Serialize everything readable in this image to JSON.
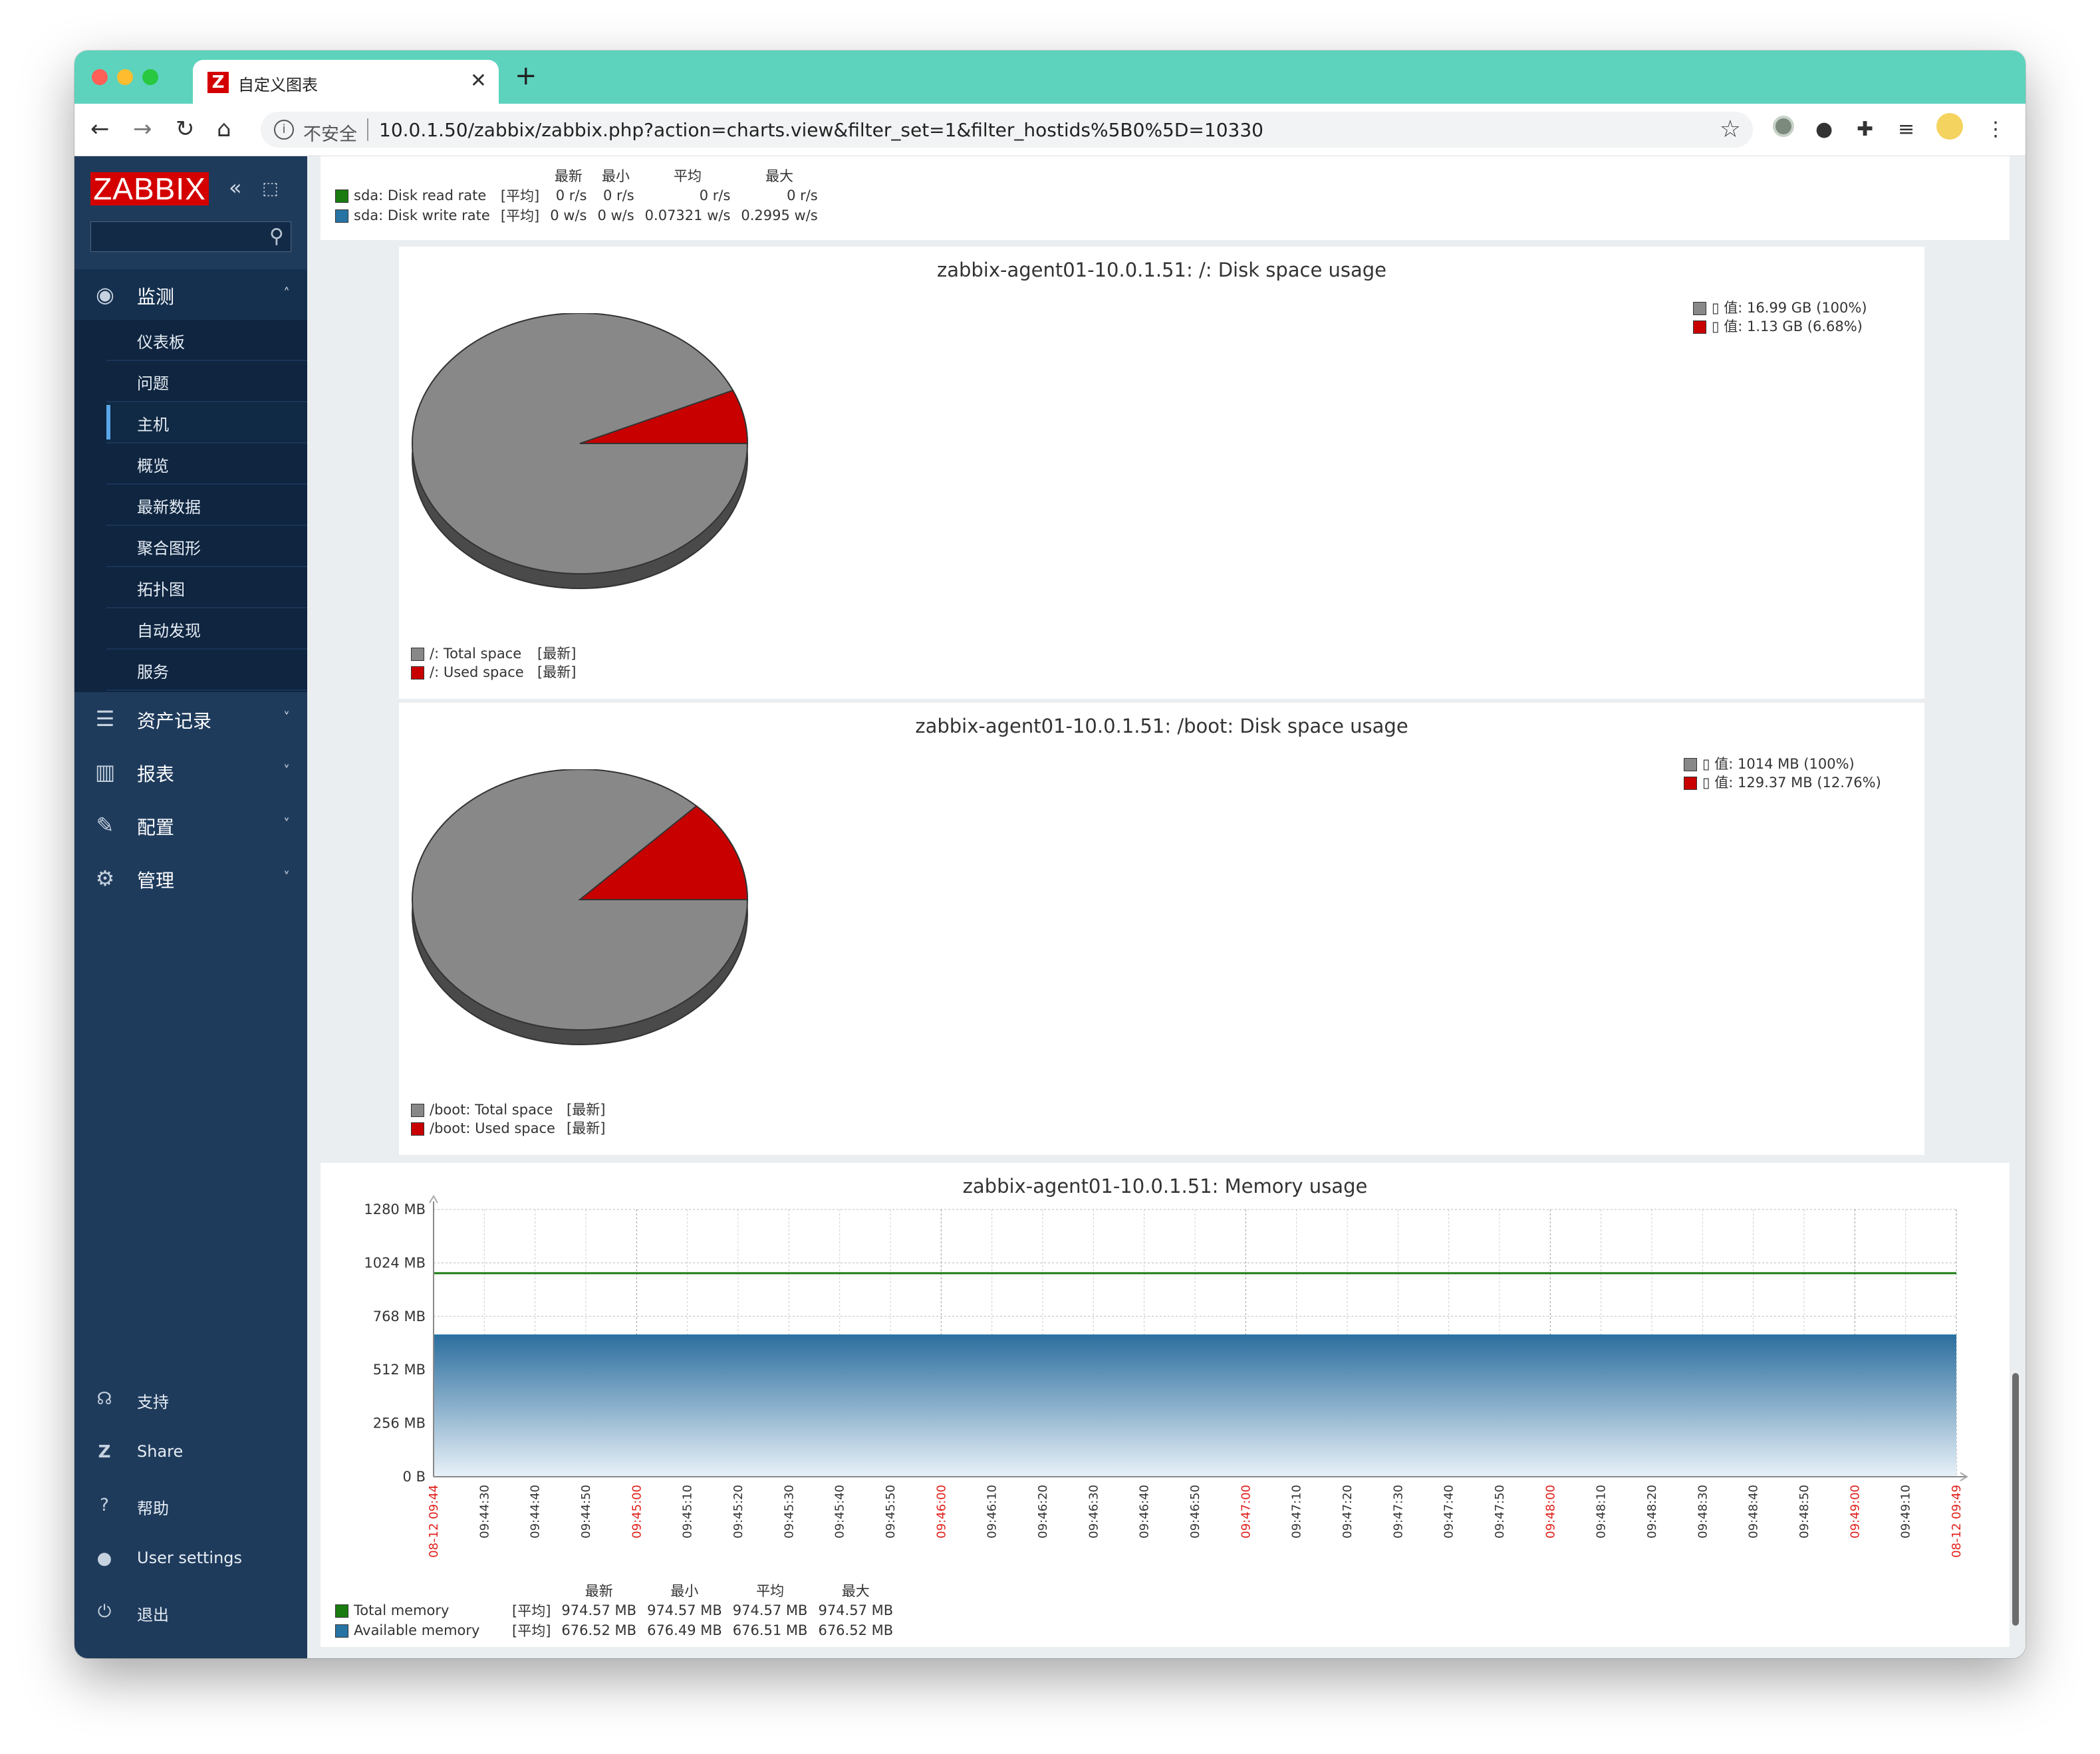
{
  "browser": {
    "tab_title": "自定义图表",
    "tab_favicon": "Z",
    "security_label": "不安全",
    "url": "10.0.1.50/zabbix/zabbix.php?action=charts.view&filter_set=1&filter_hostids%5B0%5D=10330",
    "icons": [
      "back-icon",
      "forward-icon",
      "reload-icon",
      "home-icon",
      "info-icon",
      "star-icon",
      "extension-icon",
      "bulb-icon",
      "puzzle-icon",
      "playlist-icon",
      "avatar-icon",
      "menu-icon"
    ]
  },
  "sidebar": {
    "logo": "ZABBIX",
    "search_placeholder": "",
    "menu": [
      {
        "label": "监测",
        "icon": "eye-icon",
        "expanded": true
      },
      {
        "label": "资产记录",
        "icon": "list-icon"
      },
      {
        "label": "报表",
        "icon": "bar-chart-icon"
      },
      {
        "label": "配置",
        "icon": "wrench-icon"
      },
      {
        "label": "管理",
        "icon": "gear-icon"
      }
    ],
    "submenu": [
      "仪表板",
      "问题",
      "主机",
      "概览",
      "最新数据",
      "聚合图形",
      "拓扑图",
      "自动发现",
      "服务"
    ],
    "active_submenu": "主机",
    "footer": [
      {
        "label": "支持",
        "icon": "headset-icon"
      },
      {
        "label": "Share",
        "icon": "zabbix-share-icon"
      },
      {
        "label": "帮助",
        "icon": "question-icon"
      },
      {
        "label": "User settings",
        "icon": "user-icon"
      },
      {
        "label": "退出",
        "icon": "power-icon"
      }
    ]
  },
  "disk_rate_legend": {
    "headers": [
      "最新",
      "最小",
      "平均",
      "最大"
    ],
    "rows": [
      {
        "name": "sda: Disk read rate",
        "func": "[平均]",
        "color": "#1a7c10",
        "last": "0 r/s",
        "min": "0 r/s",
        "avg": "0 r/s",
        "max": "0 r/s"
      },
      {
        "name": "sda: Disk write rate",
        "func": "[平均]",
        "color": "#2774a4",
        "last": "0 w/s",
        "min": "0 w/s",
        "avg": "0.07321 w/s",
        "max": "0.2995 w/s"
      }
    ]
  },
  "pie_root": {
    "title": "zabbix-agent01-10.0.1.51: /: Disk space usage",
    "values": [
      {
        "label": "/: Total space",
        "func": "[最新]",
        "value_text": "▯ 值: 16.99 GB (100%)",
        "color": "#888888"
      },
      {
        "label": "/: Used space",
        "func": "[最新]",
        "value_text": "▯ 值: 1.13 GB (6.68%)",
        "color": "#c80000"
      }
    ],
    "used_fraction": 0.0668
  },
  "pie_boot": {
    "title": "zabbix-agent01-10.0.1.51: /boot: Disk space usage",
    "values": [
      {
        "label": "/boot: Total space",
        "func": "[最新]",
        "value_text": "▯ 值: 1014 MB (100%)",
        "color": "#888888"
      },
      {
        "label": "/boot: Used space",
        "func": "[最新]",
        "value_text": "▯ 值: 129.37 MB (12.76%)",
        "color": "#c80000"
      }
    ],
    "used_fraction": 0.1276
  },
  "memory_legend": {
    "headers": [
      "最新",
      "最小",
      "平均",
      "最大"
    ],
    "rows": [
      {
        "name": "Total memory",
        "func": "[平均]",
        "color": "#1a7c10",
        "last": "974.57 MB",
        "min": "974.57 MB",
        "avg": "974.57 MB",
        "max": "974.57 MB"
      },
      {
        "name": "Available memory",
        "func": "[平均]",
        "color": "#2774a4",
        "last": "676.52 MB",
        "min": "676.49 MB",
        "avg": "676.51 MB",
        "max": "676.52 MB"
      }
    ]
  },
  "chart_data": {
    "type": "area",
    "title": "zabbix-agent01-10.0.1.51: Memory usage",
    "y_unit": "MB",
    "ylim": [
      0,
      1280
    ],
    "y_ticks": [
      "0 B",
      "256 MB",
      "512 MB",
      "768 MB",
      "1024 MB",
      "1280 MB"
    ],
    "y_tick_values": [
      0,
      256,
      512,
      768,
      1024,
      1280
    ],
    "x_ticks": [
      "08-12 09:44",
      "09:44:30",
      "09:44:40",
      "09:44:50",
      "09:45:00",
      "09:45:10",
      "09:45:20",
      "09:45:30",
      "09:45:40",
      "09:45:50",
      "09:46:00",
      "09:46:10",
      "09:46:20",
      "09:46:30",
      "09:46:40",
      "09:46:50",
      "09:47:00",
      "09:47:10",
      "09:47:20",
      "09:47:30",
      "09:47:40",
      "09:47:50",
      "09:48:00",
      "09:48:10",
      "09:48:20",
      "09:48:30",
      "09:48:40",
      "09:48:50",
      "09:49:00",
      "09:49:10",
      "08-12 09:49"
    ],
    "x_major_ticks": [
      "08-12 09:44",
      "09:45:00",
      "09:46:00",
      "09:47:00",
      "09:48:00",
      "09:49:00",
      "08-12 09:49"
    ],
    "series": [
      {
        "name": "Total memory",
        "value": 974.57,
        "color": "#1a7c10",
        "style": "line"
      },
      {
        "name": "Available memory",
        "value": 676.52,
        "color": "#2774a4",
        "style": "filled"
      }
    ],
    "grid": true
  }
}
